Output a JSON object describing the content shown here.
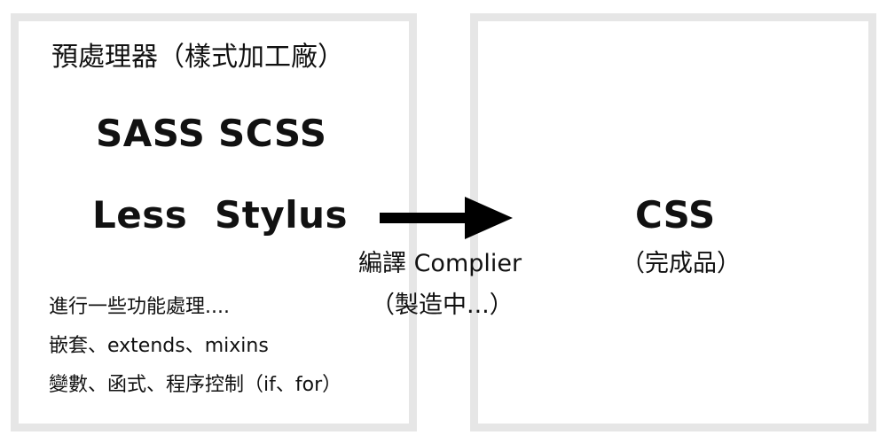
{
  "left": {
    "title": "預處理器（樣式加工廠）",
    "languages": [
      "SASS",
      "SCSS",
      "Less",
      "Stylus"
    ],
    "description": [
      "進行一些功能處理....",
      "嵌套、extends、mixins",
      "變數、函式、程序控制（if、for）"
    ]
  },
  "arrow": {
    "label_line1": "編譯 Complier",
    "label_line2": "（製造中...）"
  },
  "right": {
    "title": "CSS",
    "subtitle": "（完成品）"
  },
  "colors": {
    "panel_border": "#e6e6e6",
    "text": "#111111",
    "arrow": "#000000"
  }
}
